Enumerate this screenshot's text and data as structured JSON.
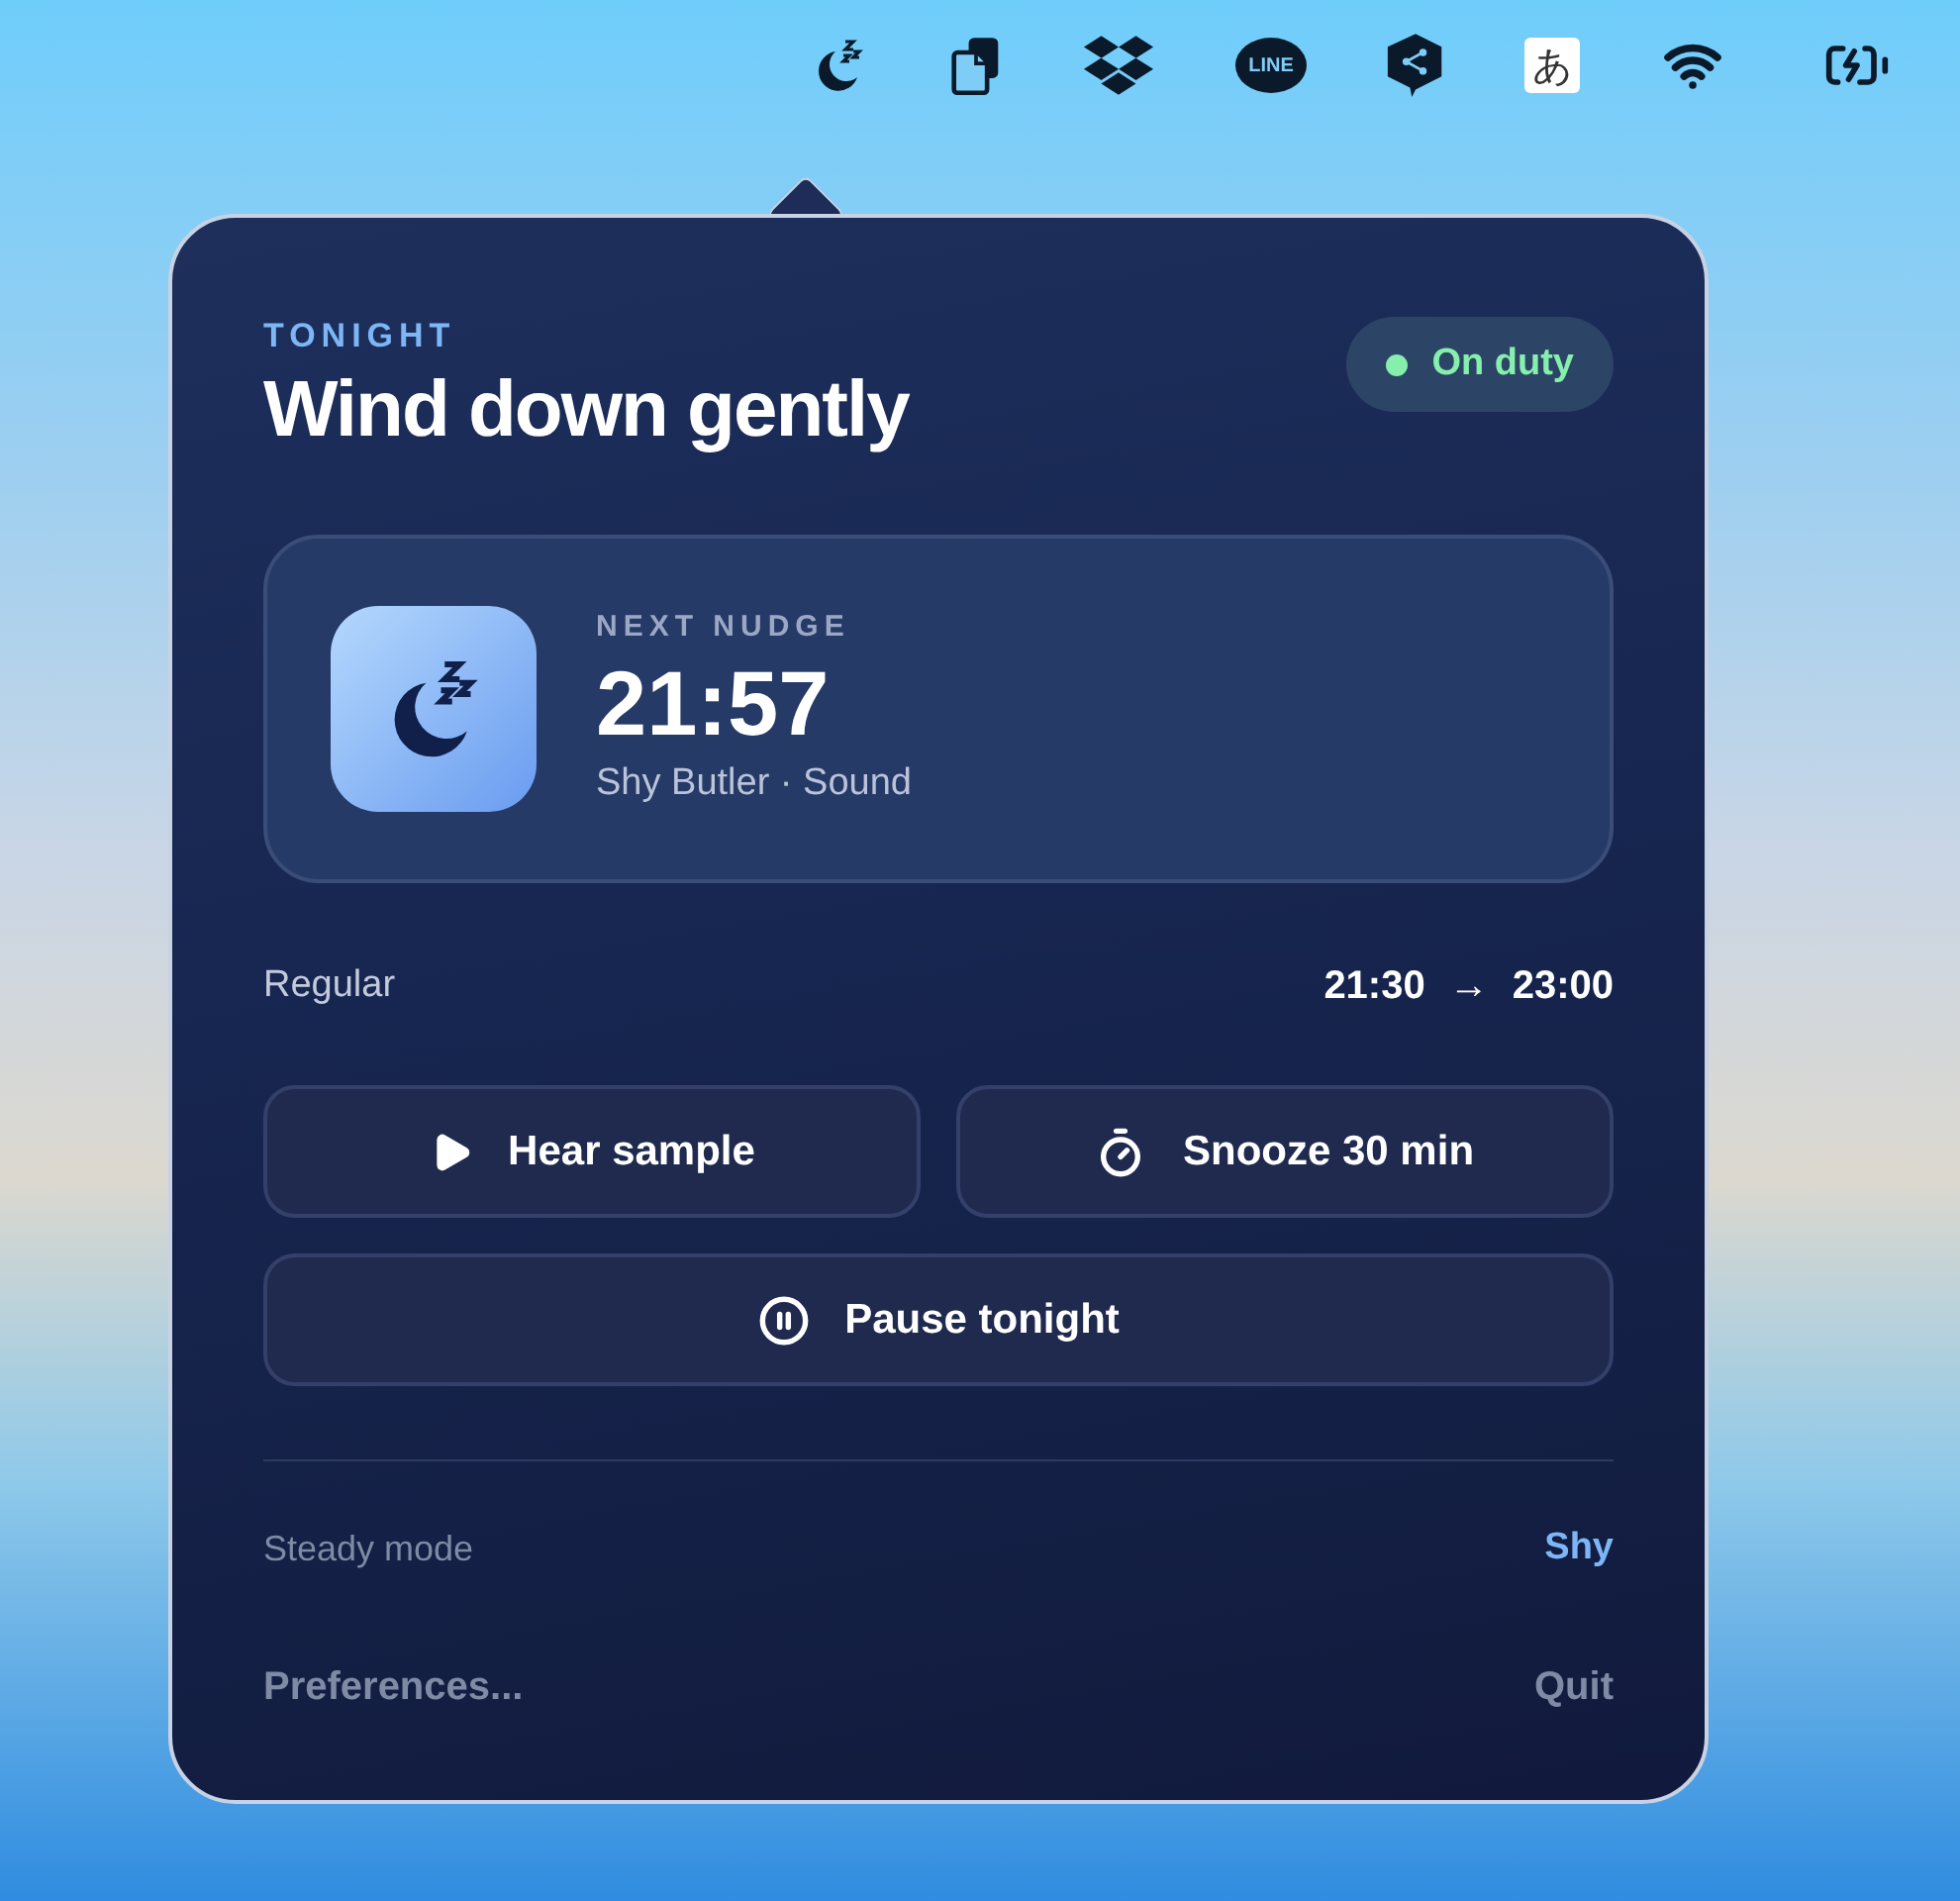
{
  "menu_bar": {
    "items": [
      {
        "kind": "sleep"
      },
      {
        "kind": "clipboard"
      },
      {
        "kind": "dropbox"
      },
      {
        "kind": "chat",
        "label": "LINE"
      },
      {
        "kind": "share"
      },
      {
        "kind": "input",
        "label": "あ"
      },
      {
        "kind": "wifi"
      },
      {
        "kind": "battery"
      }
    ]
  },
  "panel": {
    "eyebrow": "TONIGHT",
    "title": "Wind down gently",
    "status": {
      "label": "On duty",
      "on": true,
      "color": "#86efac"
    },
    "next": {
      "label": "NEXT NUDGE",
      "time": "21:57",
      "detail": "Shy Butler · Sound"
    },
    "schedule": {
      "name": "Regular",
      "start": "21:30",
      "arrow": "→",
      "end": "23:00"
    },
    "buttons": [
      {
        "kind": "play",
        "label": "Hear sample"
      },
      {
        "kind": "timer",
        "label": "Snooze 30 min"
      },
      {
        "kind": "pause",
        "label": "Pause tonight"
      }
    ],
    "mode": {
      "label": "Steady mode",
      "value": "Shy"
    },
    "footer": {
      "left": "Preferences...",
      "right": "Quit"
    }
  }
}
